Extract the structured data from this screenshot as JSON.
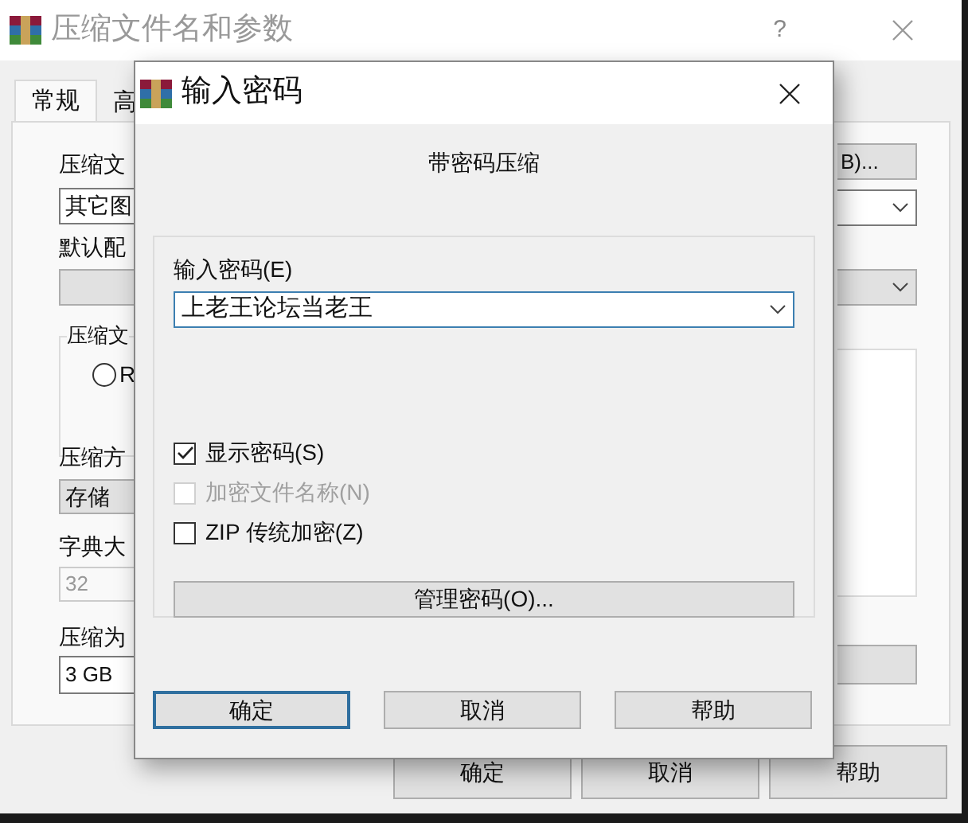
{
  "window": {
    "title": "压缩文件名和参数",
    "help_button": "?"
  },
  "tabs": [
    {
      "label": "常规",
      "selected": true
    },
    {
      "label": "高",
      "selected": false
    }
  ],
  "general": {
    "archive_name_label": "压缩文",
    "archive_name_value": "其它图",
    "browse_button": "B)...",
    "profile_label": "默认配",
    "group_label": "压缩文",
    "radio": {
      "label": "R",
      "selected": false
    },
    "method_label": "压缩方",
    "method_value": "存储",
    "dict_label": "字典大",
    "dict_field": {
      "value": "32",
      "disabled": true
    },
    "split_label": "压缩为",
    "split_value": "3 GB"
  },
  "buttons": [
    "确定",
    "取消",
    "帮助"
  ],
  "dialog": {
    "title": "输入密码",
    "heading": "带密码压缩",
    "password_label": "输入密码(E)",
    "password_value": "上老王论坛当老王",
    "options": [
      {
        "label": "显示密码(S)",
        "checked": true,
        "disabled": false
      },
      {
        "label": "加密文件名称(N)",
        "checked": false,
        "disabled": true
      },
      {
        "label": "ZIP 传统加密(Z)",
        "checked": false,
        "disabled": false
      }
    ],
    "manage_button": "管理密码(O)...",
    "buttons": [
      {
        "label": "确定",
        "focused": true
      },
      {
        "label": "取消",
        "focused": false
      },
      {
        "label": "帮助",
        "focused": false
      }
    ]
  }
}
